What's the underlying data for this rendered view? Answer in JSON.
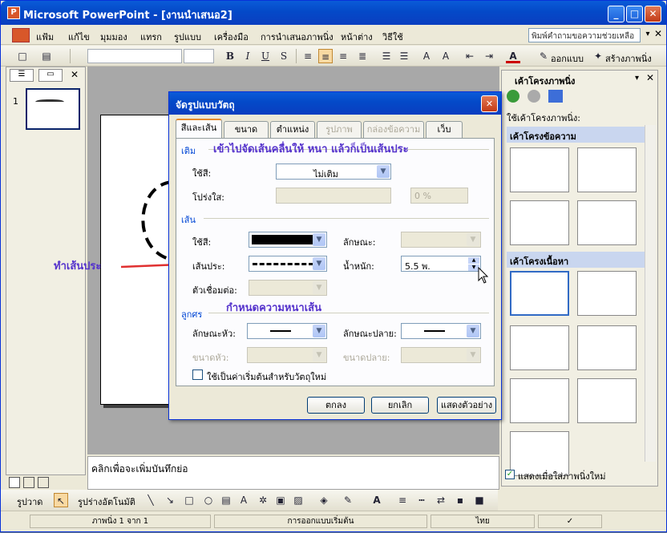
{
  "window": {
    "title": "Microsoft PowerPoint - [งานนำเสนอ2]",
    "app_icon": "P"
  },
  "menu": {
    "items": [
      "แฟ้ม",
      "แก้ไข",
      "มุมมอง",
      "แทรก",
      "รูปแบบ",
      "เครื่องมือ",
      "การนำเสนอภาพนิ่ง",
      "หน้าต่าง",
      "วิธีใช้"
    ],
    "help_placeholder": "พิมพ์คำถามขอความช่วยเหลือ"
  },
  "toolbar": {
    "bold": "B",
    "italic": "I",
    "underline": "U",
    "shadow": "S",
    "font_color": "A",
    "design_label": "ออกแบบ",
    "new_slide_label": "สร้างภาพนิ่ง"
  },
  "slides_panel": {
    "slide_number": "1"
  },
  "notes": {
    "placeholder": "คลิกเพื่อจะเพิ่มบันทึกย่อ"
  },
  "draw_toolbar": {
    "draw_label": "รูปวาด",
    "autoshapes_label": "รูปร่างอัตโนมัติ"
  },
  "status": {
    "slide": "ภาพนิ่ง 1 จาก 1",
    "design": "การออกแบบเริ่มต้น",
    "language": "ไทย"
  },
  "task_pane": {
    "title": "เค้าโครงภาพนิ่ง",
    "apply_label": "ใช้เค้าโครงภาพนิ่ง:",
    "section_text": "เค้าโครงข้อความ",
    "section_content": "เค้าโครงเนื้อหา",
    "show_on_insert": "แสดงเมื่อใส่ภาพนิ่งใหม่"
  },
  "dialog": {
    "title": "จัดรูปแบบวัตถุ",
    "tabs": [
      "สีและเส้น",
      "ขนาด",
      "ตำแหน่ง",
      "รูปภาพ",
      "กล่องข้อความ",
      "เว็บ"
    ],
    "fill": {
      "group": "เติม",
      "color_label": "ใช้สี:",
      "color_value": "ไม่เติม",
      "transparency_label": "โปร่งใส:",
      "transparency_value": "0 %"
    },
    "line": {
      "group": "เส้น",
      "color_label": "ใช้สี:",
      "style_label": "ลักษณะ:",
      "dashed_label": "เส้นประ:",
      "weight_label": "น้ำหนัก:",
      "weight_value": "5.5 พ.",
      "connector_label": "ตัวเชื่อมต่อ:"
    },
    "arrows": {
      "group": "ลูกศร",
      "begin_style_label": "ลักษณะหัว:",
      "end_style_label": "ลักษณะปลาย:",
      "begin_size_label": "ขนาดหัว:",
      "end_size_label": "ขนาดปลาย:"
    },
    "default_checkbox": "ใช้เป็นค่าเริ่มต้นสำหรับวัตถุใหม่",
    "ok": "ตกลง",
    "cancel": "ยกเลิก",
    "preview": "แสดงตัวอย่าง"
  },
  "annotations": {
    "header_note": "เข้าไปจัดเส้นคลื่นให้ หนา แล้วก็เป็นเส้นประ",
    "dashed_note": "ทำเส้นประ",
    "weight_note": "กำหนดความหนาเส้น",
    "color": "#5533cc",
    "arrow_color": "#e03030"
  },
  "colors": {
    "title_bar": "#0449c8",
    "chrome": "#ece9d8",
    "tab_highlight": "#e68b2c"
  }
}
